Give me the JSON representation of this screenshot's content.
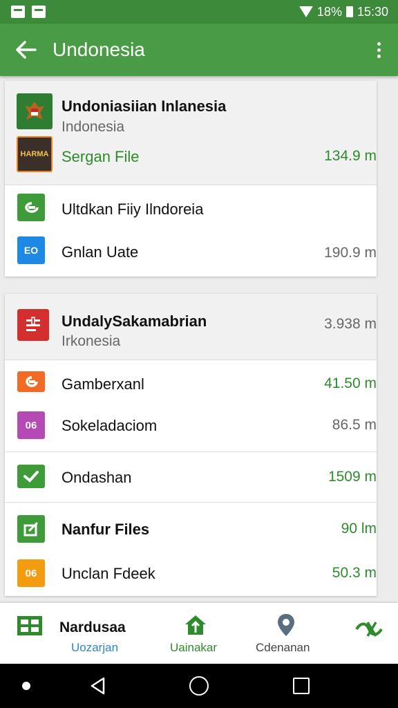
{
  "status_bar": {
    "battery": "18%",
    "time": "15:30"
  },
  "app_bar": {
    "title": "Undonesia"
  },
  "section1": {
    "header": {
      "title": "Undoniasiian Inlanesia",
      "subtitle": "Indonesia",
      "file_label": "Sergan File",
      "file_size": "134.9 m",
      "thumb_text": "HARMA"
    },
    "rows": [
      {
        "label": "Ultdkan Fiiy Ilndoreia",
        "size": ""
      },
      {
        "label": "Gnlan Uate",
        "size": "190.9 m",
        "icon_text": "EO"
      }
    ]
  },
  "section2": {
    "header": {
      "title": "UndalySakamabrian",
      "subtitle": "Irkonesia",
      "size": "3.938 m"
    },
    "rows": [
      {
        "label": "Gamberxanl",
        "size": "41.50 m"
      },
      {
        "label": "Sokeladaciom",
        "size": "86.5 m",
        "icon_text": "06"
      },
      {
        "label": "Ondashan",
        "size": "1509 m"
      },
      {
        "label": "Nanfur Files",
        "size": "90 lm"
      },
      {
        "label": "Unclan Fdeek",
        "size": "50.3 m",
        "icon_text": "06"
      }
    ]
  },
  "bottom_nav": {
    "items": [
      {
        "title": "Nardusaa",
        "label": "Uozarjan"
      },
      {
        "label": "Uainakar"
      },
      {
        "label": "Cdenanan"
      },
      {
        "label": ""
      }
    ]
  },
  "colors": {
    "primary": "#4a9b45",
    "status": "#3c8a3a",
    "accent_green": "#2e8b2b"
  }
}
